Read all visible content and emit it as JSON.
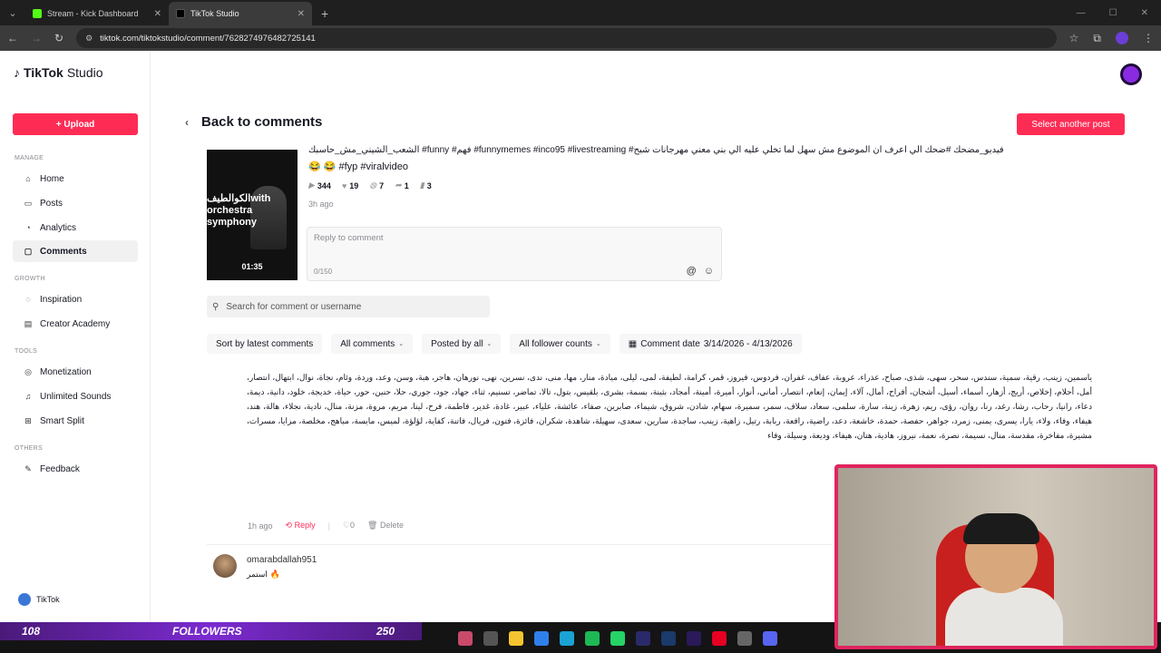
{
  "browser": {
    "tabs": [
      {
        "label": "Stream - Kick Dashboard",
        "color": "#53fc18"
      },
      {
        "label": "TikTok Studio",
        "color": "#000000"
      }
    ],
    "url": "tiktok.com/tiktokstudio/comment/7628274976482725141"
  },
  "sidebar": {
    "brand": "TikTok",
    "brand_suffix": "Studio",
    "upload_label": "+ Upload",
    "sections": {
      "manage": "MANAGE",
      "growth": "GROWTH",
      "tools": "TOOLS",
      "others": "OTHERS"
    },
    "items": {
      "home": "Home",
      "posts": "Posts",
      "analytics": "Analytics",
      "comments": "Comments",
      "inspiration": "Inspiration",
      "creator_academy": "Creator Academy",
      "monetization": "Monetization",
      "unlimited_sounds": "Unlimited Sounds",
      "smart_split": "Smart Split",
      "feedback": "Feedback"
    },
    "footer_label": "TikTok"
  },
  "header": {
    "back_label": "Back to comments",
    "select_post_label": "Select another post"
  },
  "post": {
    "thumb_text": "الكوالطيفwith orchestra symphony",
    "duration": "01:35",
    "caption": "الشعب_الشيني_مش_حاسبك #funny #فهم #funnymemes #inco95 #livestreaming #فيديو_مضحك #ضحك الي اعرف ان الموضوع مش سهل لما تخلي عليه الي بني معني مهرجانات شبح",
    "tags": "😂 😂 #fyp #viralvideo",
    "stats": {
      "views": "344",
      "likes": "19",
      "comments": "7",
      "shares": "1",
      "saves": "3"
    },
    "ago": "3h ago"
  },
  "reply": {
    "placeholder": "Reply to comment",
    "counter": "0/150"
  },
  "search": {
    "placeholder": "Search for comment or username"
  },
  "filters": {
    "sort": "Sort by latest comments",
    "all_comments": "All comments",
    "posted_by": "Posted by all",
    "follower_counts": "All follower counts",
    "date_label": "Comment date",
    "date_range": "3/14/2026 - 4/13/2026"
  },
  "comment1": {
    "text": "ياسمين، زينب، رقية، سمية، سندس، سحر، سهى، شذى، صباح، عذراء، عروبة، عفاف، غفران، فردوس، فيروز، قمر، كرامة، لطيفة، لمى، ليلى، ميادة، منار، مها، منى، ندى، نسرين، نهى، نورهان، هاجر، هبة، وسن، وعد، وردة، وئام، نجاة، نوال، ابتهال، انتصار، أمل، أحلام، إخلاص، أريج، أزهار، أسماء، أسيل، أشجان، أفراح، أمال، آلاء، إيمان، إنعام، انتصار، أماني، أنوار، أميرة، أمينة، أمجاد، بثينة، بسمة، بشرى، بلقيس، بتول، تالا، تماضر، تسنيم، ثناء، جهاد، جود، جوري، حلا، حنين، حور، حياة، خديجة، خلود، دانية، ديمة، دعاء، رانيا، رحاب، رشا، رغد، رنا، روان، رؤى، ريم، زهرة، زينة، سارة، سلمى، سعاد، سلاف، سمر، سميرة، سهام، شادن، شروق، شيماء، صابرين، صفاء، عائشة، علياء، عبير، غادة، غدير، فاطمة، فرح، لينا، مريم، مروة، مزنة، منال، نادية، نجلاء، هالة، هند، هيفاء، وفاء، ولاء، يارا، يسرى، يمنى، زمرد، جواهر، حفصة، حمدة، خاشعة، دعد، راضية، رافعة، ربابة، رتيل، زاهية، زينب، ساجدة، سارين، سعدى، سهيلة، شاهدة، شكران، فائزة، فتون، فريال، فاتنة، كفاية، لؤلؤة، لميس، مايسة، مباهج، مخلصة، مزايا، مسرات، مشيرة، مفاخرة، مقدسة، منال، نسيمة، نصرة، نعمة، نيروز، هادية، هتان، هيفاء، وديعة، وسيلة، وفاء",
    "ago": "1h ago",
    "reply_label": "Reply",
    "likes": "0",
    "delete_label": "Delete"
  },
  "comment2": {
    "username": "omarabdallah951",
    "text": "استمر 🔥"
  },
  "overlay": {
    "followers_left": "108",
    "followers_label": "FOLLOWERS",
    "followers_right": "250"
  }
}
